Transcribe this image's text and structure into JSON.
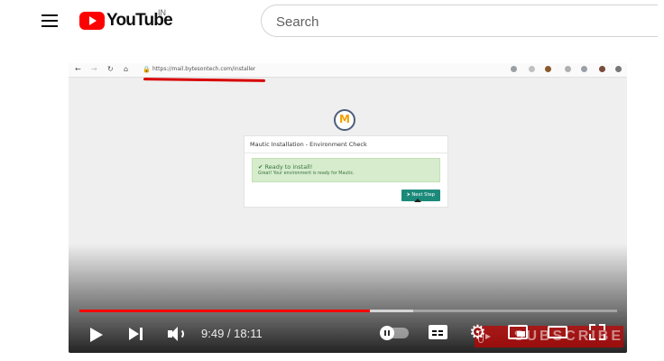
{
  "header": {
    "logo_text": "YouTube",
    "country_code": "IN",
    "search_placeholder": "Search"
  },
  "video": {
    "inner_browser": {
      "url": "https://mail.bytesontech.com/installer"
    },
    "installer": {
      "title": "Mautic Installation - Environment Check",
      "alert_title": "✔ Ready to install!",
      "alert_message": "Great! Your environment is ready for Mautic.",
      "next_button": "⮞ Next Step"
    },
    "controls": {
      "time_display": "9:49 / 18:11",
      "progress_played_fraction": 0.54,
      "progress_buffered_fraction": 0.62,
      "watermark_text": "SUBSCRIBE"
    }
  },
  "colors": {
    "brand_red": "#ff0000",
    "mautic_teal": "#1c8a7a",
    "alert_green": "#d6eccd"
  }
}
